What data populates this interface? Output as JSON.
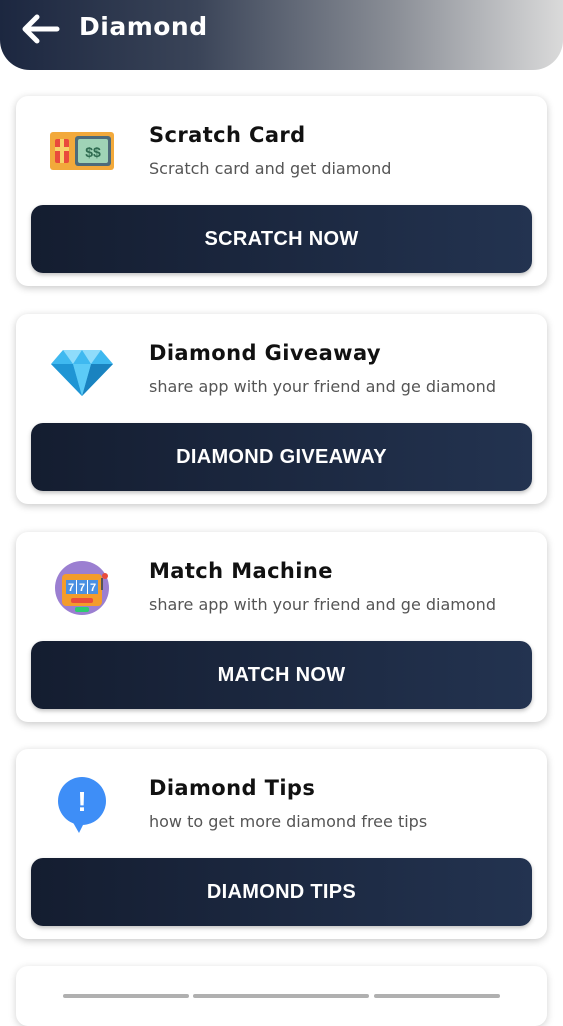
{
  "header": {
    "title": "Diamond",
    "back_icon": "arrow-left-icon"
  },
  "cards": [
    {
      "title": "Scratch Card",
      "subtitle": "Scratch card and get diamond",
      "button": "SCRATCH NOW",
      "icon": "scratch-card-icon"
    },
    {
      "title": "Diamond Giveaway",
      "subtitle": "share app with your friend and ge diamond",
      "button": "DIAMOND GIVEAWAY",
      "icon": "diamond-icon"
    },
    {
      "title": "Match Machine",
      "subtitle": "share app with your friend and ge diamond",
      "button": "MATCH NOW",
      "icon": "slot-machine-icon"
    },
    {
      "title": "Diamond Tips",
      "subtitle": "how to get more diamond free tips",
      "button": "DIAMOND TIPS",
      "icon": "alert-bubble-icon"
    }
  ],
  "scratch_icon_text": "$$",
  "slot_icon_text": [
    "7",
    "7",
    "7"
  ],
  "tips_icon_text": "!",
  "colors": {
    "button_dark": "#1a2540",
    "header_start": "#1c2740",
    "header_end": "#dadada"
  }
}
